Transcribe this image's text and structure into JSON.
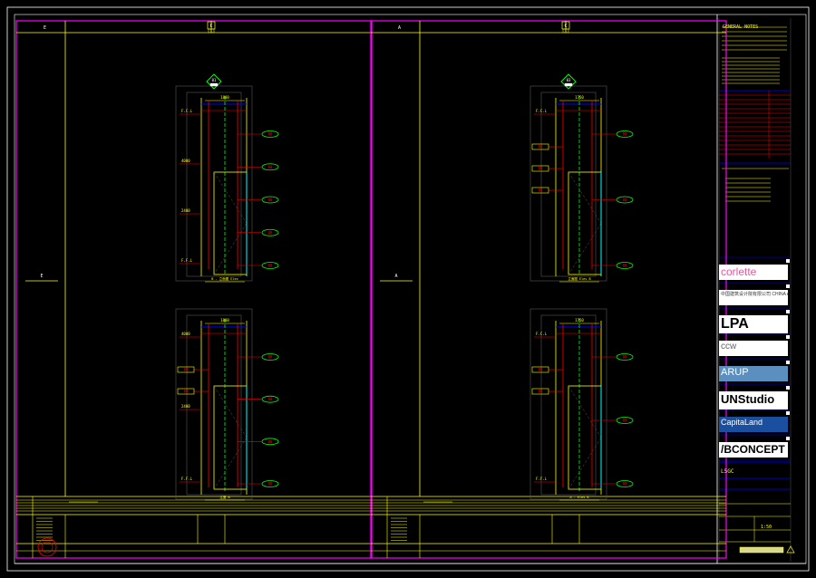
{
  "drawing": {
    "bg_color": "#000000",
    "colors": {
      "frame": "#ffffff",
      "panel": "#ff00ff",
      "wall": "#ffff00",
      "dim": "#ff0000",
      "hidden": "#00ff00",
      "beam": "#0000ff",
      "door": "#00ffff",
      "grey": "#555555",
      "tag_fill": "#ffffff"
    },
    "panels": [
      {
        "id": "left",
        "grid_label_left": "E",
        "grid_label_top": "C",
        "grid_label_mid": "E",
        "elevations": [
          {
            "top_tag": "01",
            "dim_top": "1800",
            "levels": [
              "F.C.L",
              "4000",
              "2400",
              "F.F.L"
            ],
            "labels_right": [
              "00",
              "00",
              "00",
              "00",
              "00"
            ],
            "labels_left": [],
            "caption": "B - 立面图 Elev"
          },
          {
            "top_tag": "02",
            "dim_top": "1800",
            "levels": [
              "4000",
              "2400",
              "F.F.L"
            ],
            "labels_right": [
              "00",
              "00",
              "00",
              "00"
            ],
            "labels_left": [
              "00",
              "00"
            ],
            "caption": "立面 B"
          }
        ]
      },
      {
        "id": "right",
        "grid_label_left": "A",
        "grid_label_top": "C",
        "grid_label_mid": "A",
        "elevations": [
          {
            "top_tag": "03",
            "dim_top": "1750",
            "levels": [
              "F.C.L"
            ],
            "labels_right": [
              "00",
              "00",
              "00"
            ],
            "labels_left": [
              "00",
              "00",
              "00"
            ],
            "caption": "立面图 Elev B"
          },
          {
            "top_tag": "04",
            "dim_top": "1750",
            "levels": [
              "F.C.L",
              "F.F.L"
            ],
            "labels_right": [
              "00",
              "00",
              "00"
            ],
            "labels_left": [
              "00",
              "00"
            ],
            "caption": "A - Elev B"
          }
        ]
      }
    ]
  },
  "title_block": {
    "notes_heading": "GENERAL NOTES",
    "logos": [
      {
        "name": "corlette",
        "text": "corlette",
        "color": "#e05aa0",
        "bg": "#ffffff"
      },
      {
        "name": "cn-design",
        "text": "中国建筑设计院有限公司 CHINA ARCH DESIGN",
        "color": "#333333",
        "bg": "#ffffff"
      },
      {
        "name": "lpa",
        "text": "LPA",
        "color": "#000000",
        "bg": "#ffffff"
      },
      {
        "name": "ccw",
        "text": "ccw",
        "color": "#666666",
        "bg": "#ffffff"
      },
      {
        "name": "arup",
        "text": "ARUP",
        "color": "#ffffff",
        "bg": "#5b8fbf"
      },
      {
        "name": "unstudio",
        "text": "UNStudio",
        "color": "#000000",
        "bg": "#ffffff"
      },
      {
        "name": "capitaland",
        "text": "CapitaLand",
        "color": "#ffffff",
        "bg": "#1a4fa0"
      },
      {
        "name": "bconcept",
        "text": "/BCONCEPT",
        "color": "#000000",
        "bg": "#ffffff"
      }
    ],
    "project_code": "L5GC",
    "scale_text": "1:50",
    "accent": "#ffff00"
  }
}
